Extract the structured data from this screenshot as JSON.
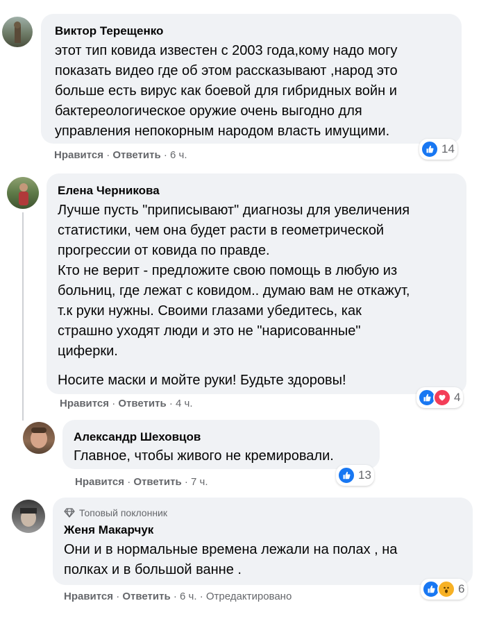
{
  "colors": {
    "like": "#1877f2",
    "love": "#f33e58",
    "wow": "#f7b125",
    "bubble": "#f0f2f5",
    "meta": "#65676b"
  },
  "comments": [
    {
      "author": "Виктор Терещенко",
      "text": "этот тип ковида известен с 2003 года,кому надо могу\nпоказать видео где об этом рассказывают ,народ это\nбольше есть вирус как боевой для гибридных войн и\nбактереологическое оружие очень выгодно для\nуправления непокорным народом власть имущими.",
      "like": "Нравится",
      "reply": "Ответить",
      "time": "6 ч.",
      "reactions": [
        "like-icon"
      ],
      "count": "14"
    },
    {
      "author": "Елена Черникова",
      "text": "Лучше пусть \"приписывают\" диагнозы для увеличения\nстатистики, чем она будет расти в геометрической\nпрогрессии от ковида по правде.\nКто не верит - предложите свою помощь в любую из\nбольниц, где лежат с ковидом.. думаю вам не откажут,\nт.к руки нужны. Своими глазами убедитесь, как\nстрашно уходят люди и это не \"нарисованные\"\nциферки.",
      "text2": "Носите маски и мойте руки! Будьте здоровы!",
      "like": "Нравится",
      "reply": "Ответить",
      "time": "4 ч.",
      "reactions": [
        "like-icon",
        "love-icon"
      ],
      "count": "4"
    },
    {
      "author": "Александр Шеховцов",
      "text": "Главное, чтобы живого не кремировали.",
      "like": "Нравится",
      "reply": "Ответить",
      "time": "7 ч.",
      "reactions": [
        "like-icon"
      ],
      "count": "13"
    },
    {
      "badge": "Топовый поклонник",
      "author": "Женя Макарчук",
      "text": "Они и в нормальные времена лежали на полах , на\nполках и в большой ванне .",
      "like": "Нравится",
      "reply": "Ответить",
      "time": "6 ч.",
      "edited": "Отредактировано",
      "reactions": [
        "like-icon",
        "wow-icon"
      ],
      "count": "6"
    }
  ]
}
